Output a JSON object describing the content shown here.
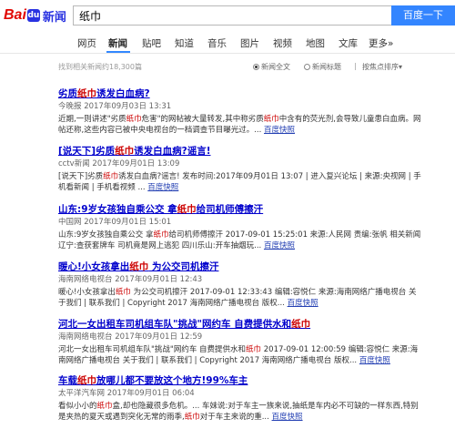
{
  "header": {
    "logo_bai": "Bai",
    "logo_paw": "du",
    "logo_du": "",
    "logo_news": "新闻",
    "search_value": "纸巾",
    "search_button": "百度一下"
  },
  "nav": {
    "items": [
      "网页",
      "新闻",
      "贴吧",
      "知道",
      "音乐",
      "图片",
      "视频",
      "地图",
      "文库",
      "更多»"
    ],
    "active": "新闻"
  },
  "toolbar": {
    "result_count": "找到相关新闻约18,300篇",
    "option_full": "新闻全文",
    "option_title": "新闻标题",
    "sort_label": "按焦点排序",
    "sort_caret": "▾"
  },
  "results": [
    {
      "title_a": "劣质",
      "title_hl": "纸巾",
      "title_b": "诱发白血病?",
      "meta": "今晚报  2017年09月03日 13:31",
      "body_a": "近期,一则讲述\"劣质",
      "body_hl": "纸巾",
      "body_b": "危害\"的网帖被大量转发,其中称劣质",
      "body_hl2": "纸巾",
      "body_c": "中含有的荧光剂,会导致儿童患白血病。网帖还称,这些内容已被中央电视台的一档调查节目曝光过。...",
      "cache": "百度快照"
    },
    {
      "title_a": "[说天下]劣质",
      "title_hl": "纸巾",
      "title_b": "诱发白血病?谣言!",
      "meta": "cctv新闻  2017年09月01日 13:09",
      "body_a": "[说天下]劣质",
      "body_hl": "纸巾",
      "body_b": "诱发白血病?谣言! 发布时间:2017年09月01日 13:07 | 进入复兴论坛 | 来源:央视网 | 手机看新闻 | 手机看视频 ...",
      "body_hl2": "",
      "body_c": "",
      "cache": "百度快照"
    },
    {
      "title_a": "山东:9岁女孩独自乘公交 拿",
      "title_hl": "纸巾",
      "title_b": "给司机师傅擦汗",
      "meta": "中国网  2017年09月01日 15:01",
      "body_a": "山东:9岁女孩独自乘公交 拿",
      "body_hl": "纸巾",
      "body_b": "给司机师傅擦汗 2017-09-01 15:25:01 来源:人民网 责编:张帆 相关新闻辽宁:查获套牌车 司机竟是网上逃犯 四川乐山:开车抽烟玩...",
      "body_hl2": "",
      "body_c": "",
      "cache": "百度快照"
    },
    {
      "title_a": "暖心!小女孩拿出",
      "title_hl": "纸巾",
      "title_b": " 为公交司机擦汗",
      "meta": "海南网络电视台  2017年09月01日 12:43",
      "body_a": "暖心!小女孩拿出",
      "body_hl": "纸巾",
      "body_b": " 为公交司机擦汗 2017-09-01 12:33:43 编辑:容悦仁 来源:海南网络广播电视台 关于我们 | 联系我们 | Copyright 2017 海南网络广播电视台 版权...",
      "body_hl2": "",
      "body_c": "",
      "cache": "百度快照"
    },
    {
      "title_a": "河北一女出租车司机组车队\"挑战\"网约车 自费提供水和",
      "title_hl": "纸巾",
      "title_b": "",
      "meta": "海南网络电视台  2017年09月01日 12:59",
      "body_a": "河北一女出租车司机组车队\"挑战\"网约车 自费提供水和",
      "body_hl": "纸巾",
      "body_b": " 2017-09-01 12:00:59 编辑:容悦仁 来源:海南网络广播电视台 关于我们 | 联系我们 | Copyright 2017 海南网络广播电视台 版权...",
      "body_hl2": "",
      "body_c": "",
      "cache": "百度快照"
    },
    {
      "title_a": "车载",
      "title_hl": "纸巾",
      "title_b": "放哪儿都不要放这个地方!99%车主",
      "meta": "太平洋汽车网  2017年09月01日 06:04",
      "body_a": "看似小小的",
      "body_hl": "纸巾",
      "body_b": "盒,却也隐藏很多危机。... 车妹说:对于车主一族来说,抽纸是车内必不可缺的一样东西,特别是夹热的夏天或遇到突化无常的雨季,",
      "body_hl2": "纸巾",
      "body_c": "对于车主来说的重...",
      "cache": "百度快照"
    }
  ]
}
